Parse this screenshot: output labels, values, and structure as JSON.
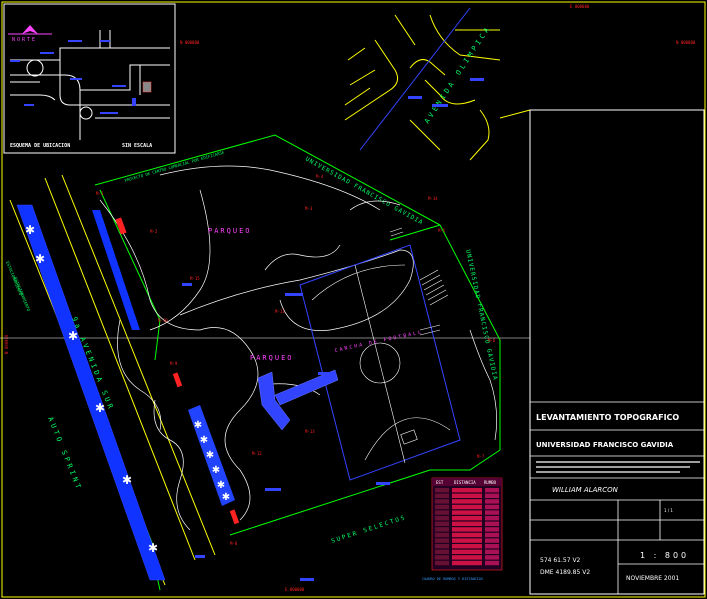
{
  "colors": {
    "background": "#000000",
    "border": "#ffff00",
    "boundary": "#00ff00",
    "building": "#3344ff",
    "label": "#ff2222",
    "white": "#ffffff",
    "magenta": "#ff44ff",
    "cyan": "#33ccff",
    "plaza": "#4455ff"
  },
  "location_map": {
    "north_label": "NORTE",
    "schema_label": "ESQUEMA DE UBICACION",
    "scale_label": "SIN ESCALA"
  },
  "streets": {
    "avenida_olimpica": "AVENIDA OLIMPICA",
    "avenida_sur": "9a AVENIDA SUR",
    "auto_sprint": "AUTO SPRINT",
    "super_selectos": "SUPER SELECTOS",
    "universidad_top": "UNIVERSIDAD FRANCISCO GAVIDIA",
    "universidad_right": "UNIVERSIDAD FRANCISCO GAVIDIA",
    "proyecto": "PROYECTO DE CENTRO COMERCIAL POR EDIFICARSE",
    "estacionamiento": "ESTACIONAMIENTO",
    "estacionamiento_left": "ESTACIONAMIENTO"
  },
  "site_labels": {
    "parqueo_1": "PARQUEO",
    "parqueo_2": "PARQUEO",
    "cancha": "CANCHA DE FOOTBALL"
  },
  "grid_marks": {
    "e_top": "E 000000",
    "e_bottom": "E 000000",
    "n_left": "N 000000",
    "n_right": "N 000000",
    "n_mid": "N 000000"
  },
  "table": {
    "header_1": "EST",
    "header_2": "DISTANCIA",
    "header_3": "RUMBO",
    "footer": "CUADRO DE RUMBOS Y DISTANCIAS",
    "row_count": 14
  },
  "title_block": {
    "project_title": "LEVANTAMIENTO TOPOGRAFICO",
    "owner": "UNIVERSIDAD FRANCISCO GAVIDIA",
    "surveyor": "WILLIAM ALARCON",
    "area_1": "574 61.57 V2",
    "area_2": "DME 4189.85 V2",
    "scale": "1 : 800",
    "date": "NOVIEMBRE 2001",
    "sheet": "1 / 1"
  }
}
